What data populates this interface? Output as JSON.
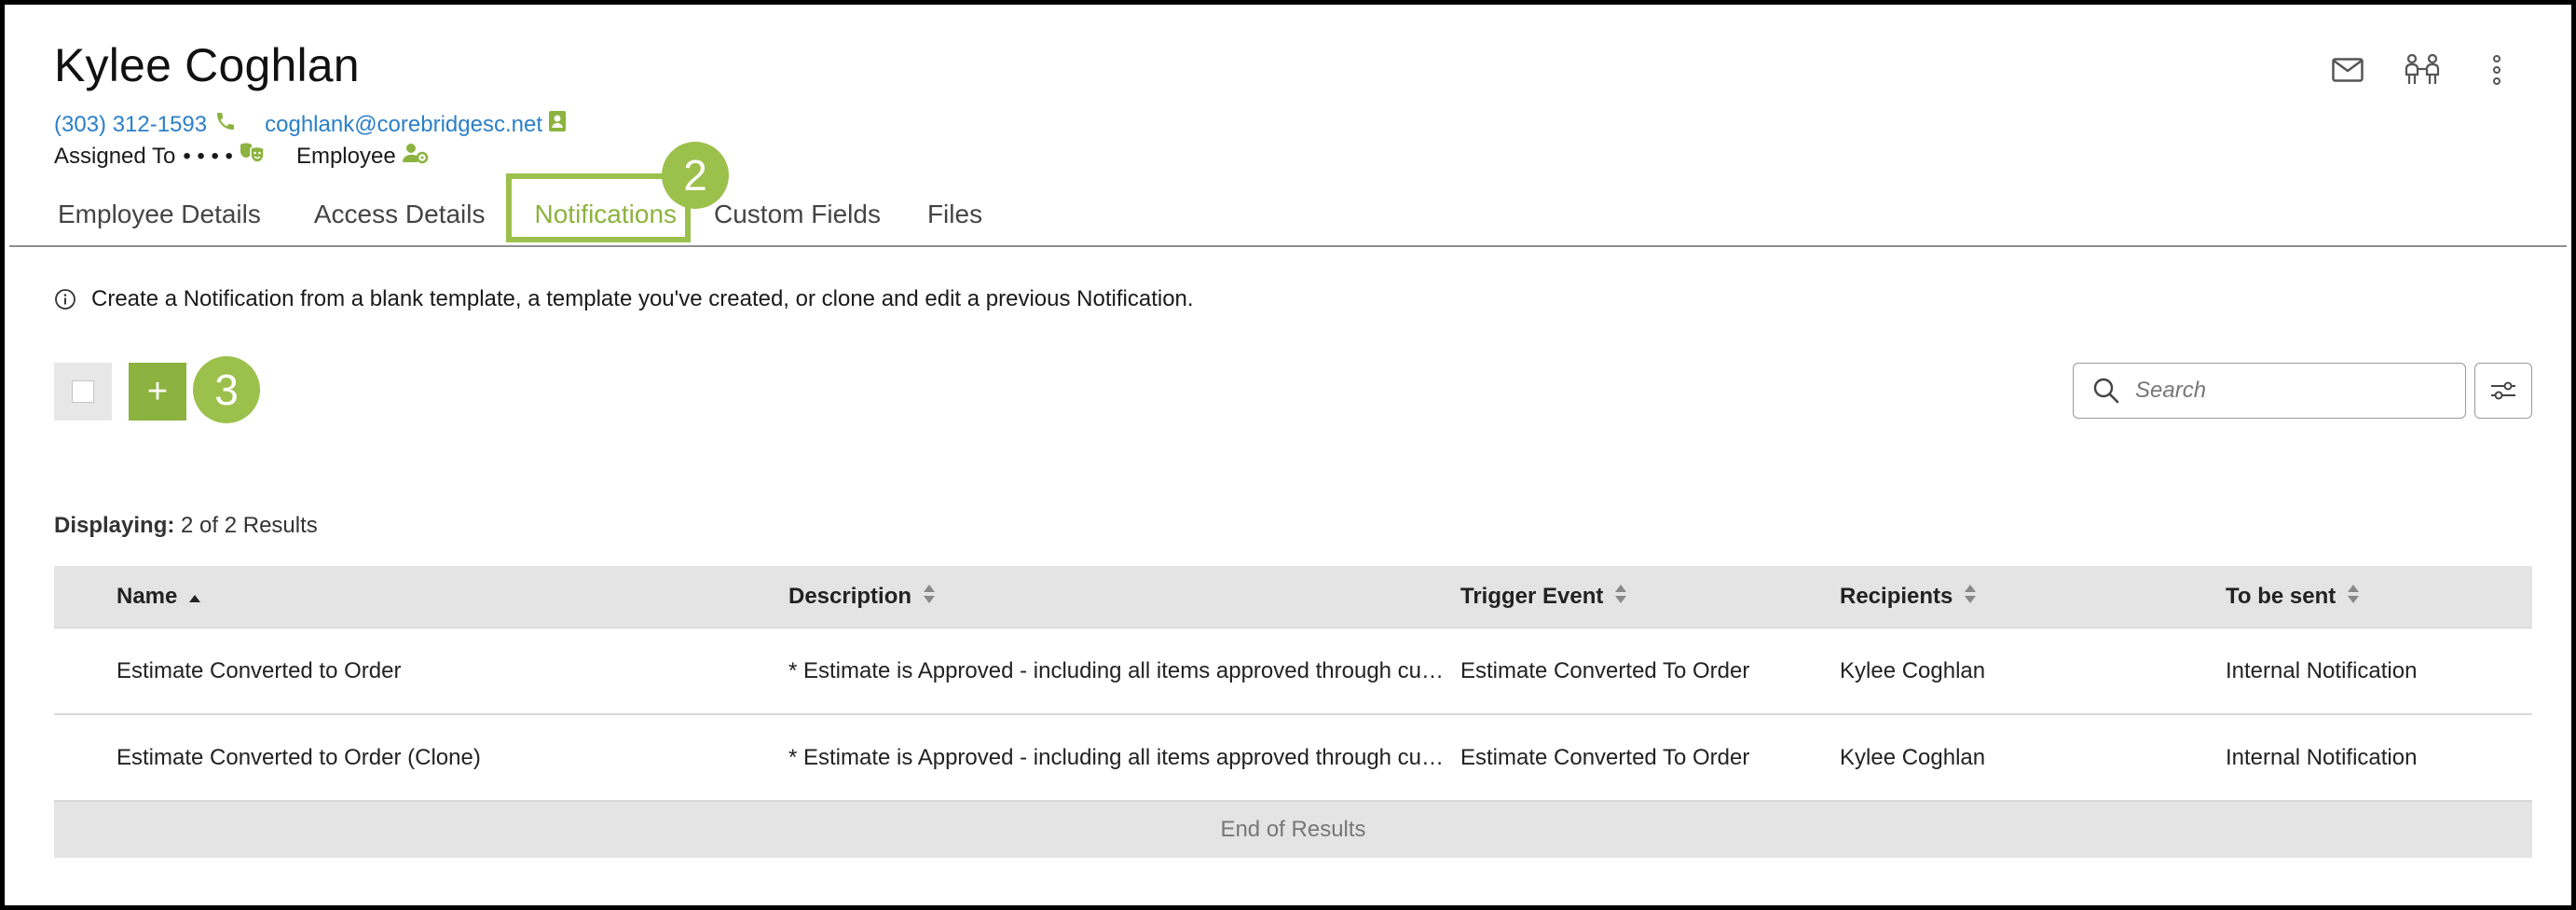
{
  "header": {
    "name": "Kylee Coghlan",
    "phone": "(303) 312-1593",
    "email": "coghlank@corebridgesc.net",
    "assigned_to_label": "Assigned To",
    "assigned_to_value": "• • • •",
    "role": "Employee",
    "icons": [
      "envelope-icon",
      "people-icon",
      "more-vertical-icon"
    ]
  },
  "tabs": [
    {
      "label": "Employee Details"
    },
    {
      "label": "Access Details"
    },
    {
      "label": "Notifications",
      "active": true
    },
    {
      "label": "Custom Fields"
    },
    {
      "label": "Files"
    }
  ],
  "badges": {
    "tab_step": "2",
    "add_step": "3"
  },
  "info": {
    "text": "Create a Notification from a blank template, a template you've created, or clone and edit a previous Notification."
  },
  "toolbar": {
    "add_label": "+",
    "search_placeholder": "Search"
  },
  "results": {
    "label": "Displaying:",
    "value": "2 of 2 Results"
  },
  "table": {
    "columns": [
      "Name",
      "Description",
      "Trigger Event",
      "Recipients",
      "To be sent"
    ],
    "rows": [
      {
        "name": "Estimate Converted to Order",
        "description": "* Estimate is Approved - including all items approved through cu…",
        "trigger": "Estimate Converted To Order",
        "recipients": "Kylee Coghlan",
        "to_be_sent": "Internal Notification"
      },
      {
        "name": "Estimate Converted to Order (Clone)",
        "description": "* Estimate is Approved - including all items approved through cu…",
        "trigger": "Estimate Converted To Order",
        "recipients": "Kylee Coghlan",
        "to_be_sent": "Internal Notification"
      }
    ],
    "footer": "End of Results"
  },
  "colors": {
    "accent": "#8cb23f",
    "badge": "#9bc04c",
    "link": "#2b7fc8",
    "header_bg": "#e4e4e4"
  }
}
